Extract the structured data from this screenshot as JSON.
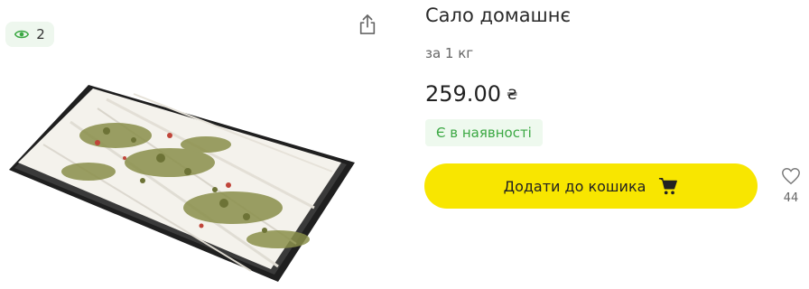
{
  "views": {
    "count": "2",
    "icon": "eye-icon"
  },
  "share": {
    "icon": "share-icon"
  },
  "product": {
    "title": "Сало домашнє",
    "unit": "за 1 кг",
    "price": "259.00",
    "currency": "₴",
    "stock_status": "Є в наявності"
  },
  "cart": {
    "label": "Додати до кошика",
    "icon": "cart-icon"
  },
  "wishlist": {
    "count": "44",
    "icon": "heart-icon"
  },
  "colors": {
    "accent": "#f8e600",
    "stock_text": "#3ba843",
    "stock_bg": "#eef9ee",
    "badge_bg": "#eef7ee"
  }
}
